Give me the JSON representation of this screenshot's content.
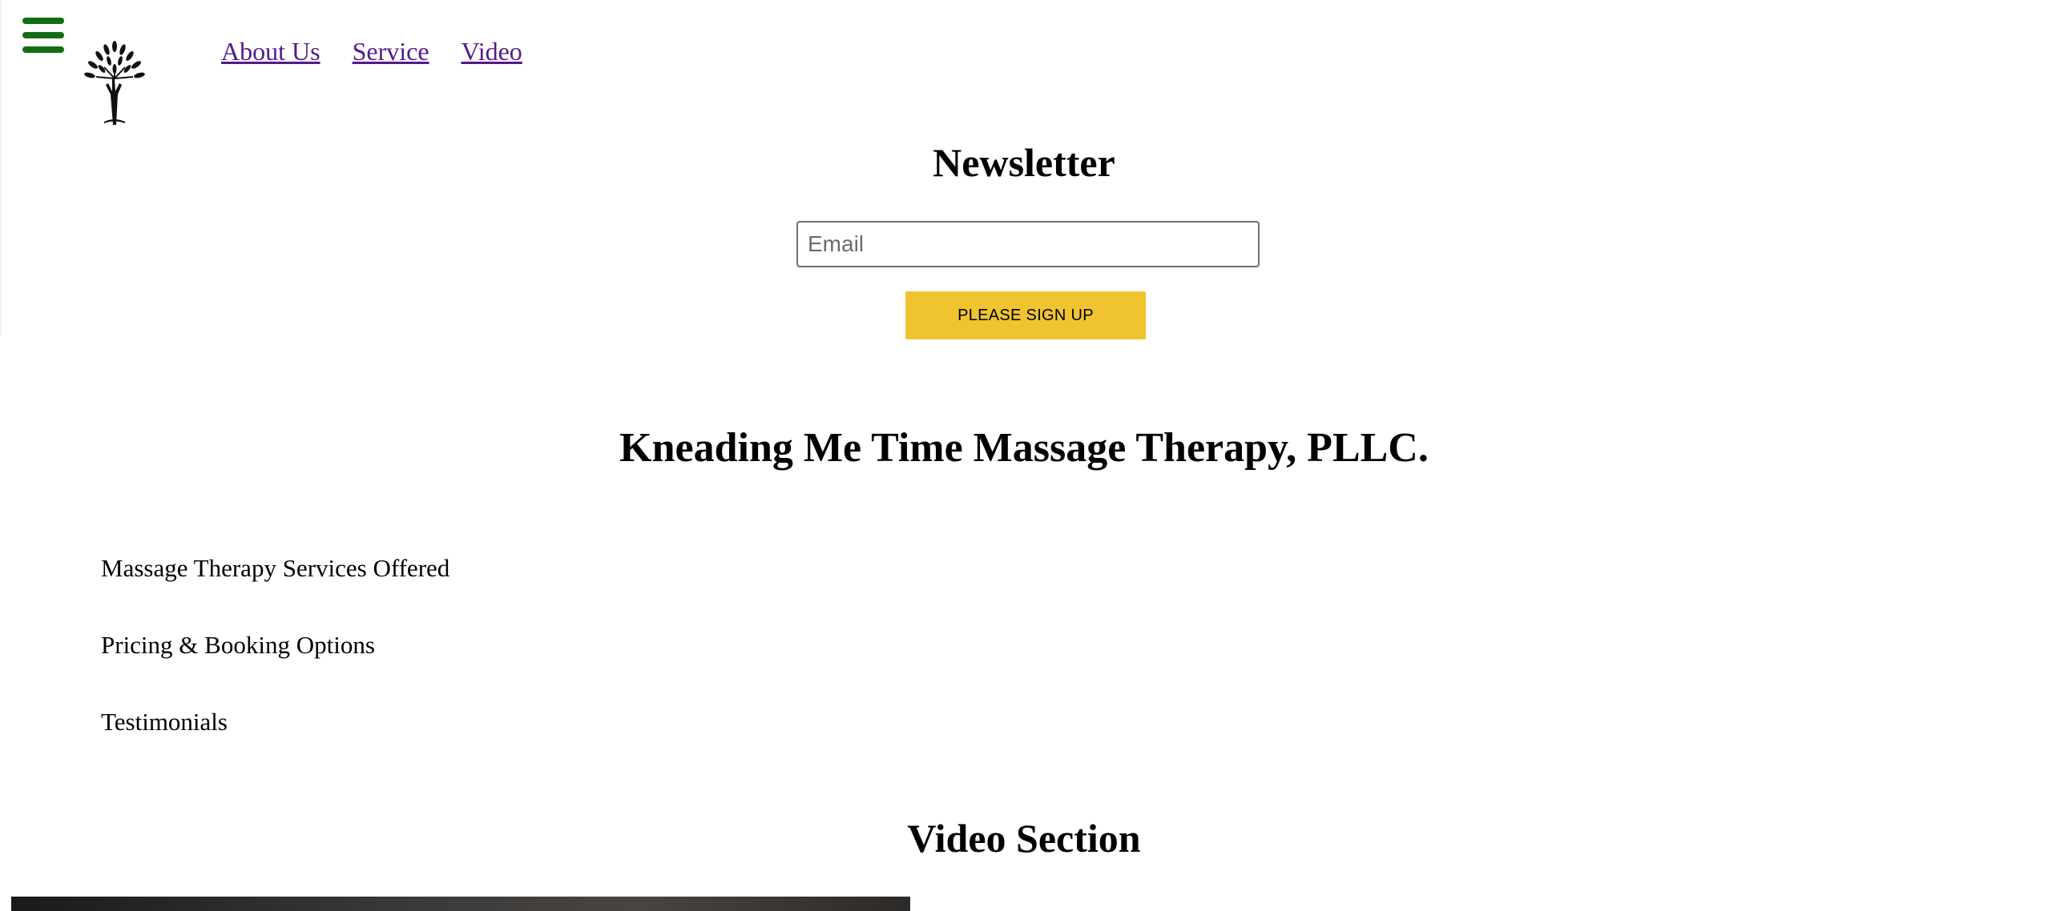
{
  "header": {
    "menu_icon": "hamburger-menu-icon",
    "logo_icon": "tree-logo-icon",
    "nav": [
      {
        "label": "About Us"
      },
      {
        "label": "Service"
      },
      {
        "label": "Video"
      }
    ]
  },
  "newsletter": {
    "title": "Newsletter",
    "email_placeholder": "Email",
    "email_value": "",
    "signup_label": "PLEASE SIGN UP"
  },
  "business": {
    "title": "Kneading Me Time Massage Therapy, PLLC."
  },
  "services": [
    "Massage Therapy Services Offered",
    "Pricing & Booking Options",
    "Testimonials"
  ],
  "video": {
    "title": "Video Section"
  },
  "colors": {
    "menu_icon": "#136d14",
    "signup_button": "#f0c430",
    "link": "#551a8b"
  }
}
